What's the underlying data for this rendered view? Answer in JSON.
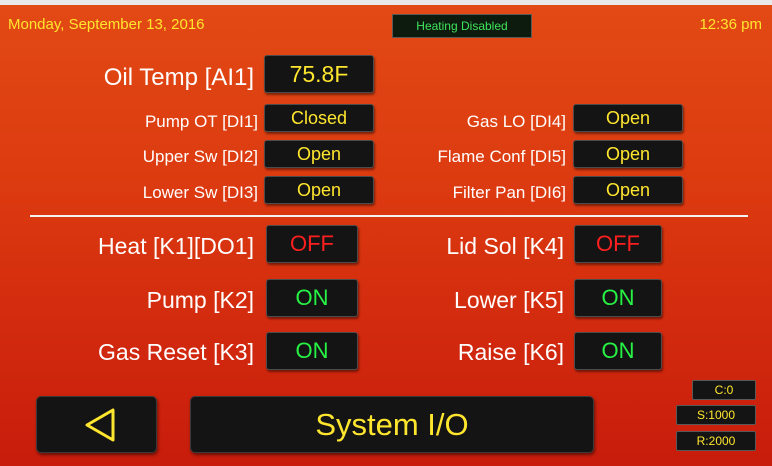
{
  "header": {
    "date": "Monday, September 13, 2016",
    "status": "Heating Disabled",
    "time": "12:36 pm"
  },
  "analog": {
    "label": "Oil Temp [AI1]",
    "value": "75.8F"
  },
  "digital_inputs": [
    {
      "label": "Pump OT [DI1]",
      "value": "Closed"
    },
    {
      "label": "Upper Sw [DI2]",
      "value": "Open"
    },
    {
      "label": "Lower Sw [DI3]",
      "value": "Open"
    },
    {
      "label": "Gas LO [DI4]",
      "value": "Open"
    },
    {
      "label": "Flame Conf [DI5]",
      "value": "Open"
    },
    {
      "label": "Filter Pan [DI6]",
      "value": "Open"
    }
  ],
  "outputs": [
    {
      "label": "Heat [K1][DO1]",
      "value": "OFF"
    },
    {
      "label": "Pump [K2]",
      "value": "ON"
    },
    {
      "label": "Gas Reset [K3]",
      "value": "ON"
    },
    {
      "label": "Lid Sol [K4]",
      "value": "OFF"
    },
    {
      "label": "Lower [K5]",
      "value": "ON"
    },
    {
      "label": "Raise [K6]",
      "value": "ON"
    }
  ],
  "footer": {
    "title": "System I/O",
    "back_icon": "triangle-left-icon",
    "counters": [
      "C:0",
      "S:1000",
      "R:2000"
    ]
  },
  "colors": {
    "value_text": "#ffe62e",
    "on_text": "#27f244",
    "off_text": "#ff1f1f",
    "status_text": "#3fe45a",
    "background": "#d8320f"
  }
}
